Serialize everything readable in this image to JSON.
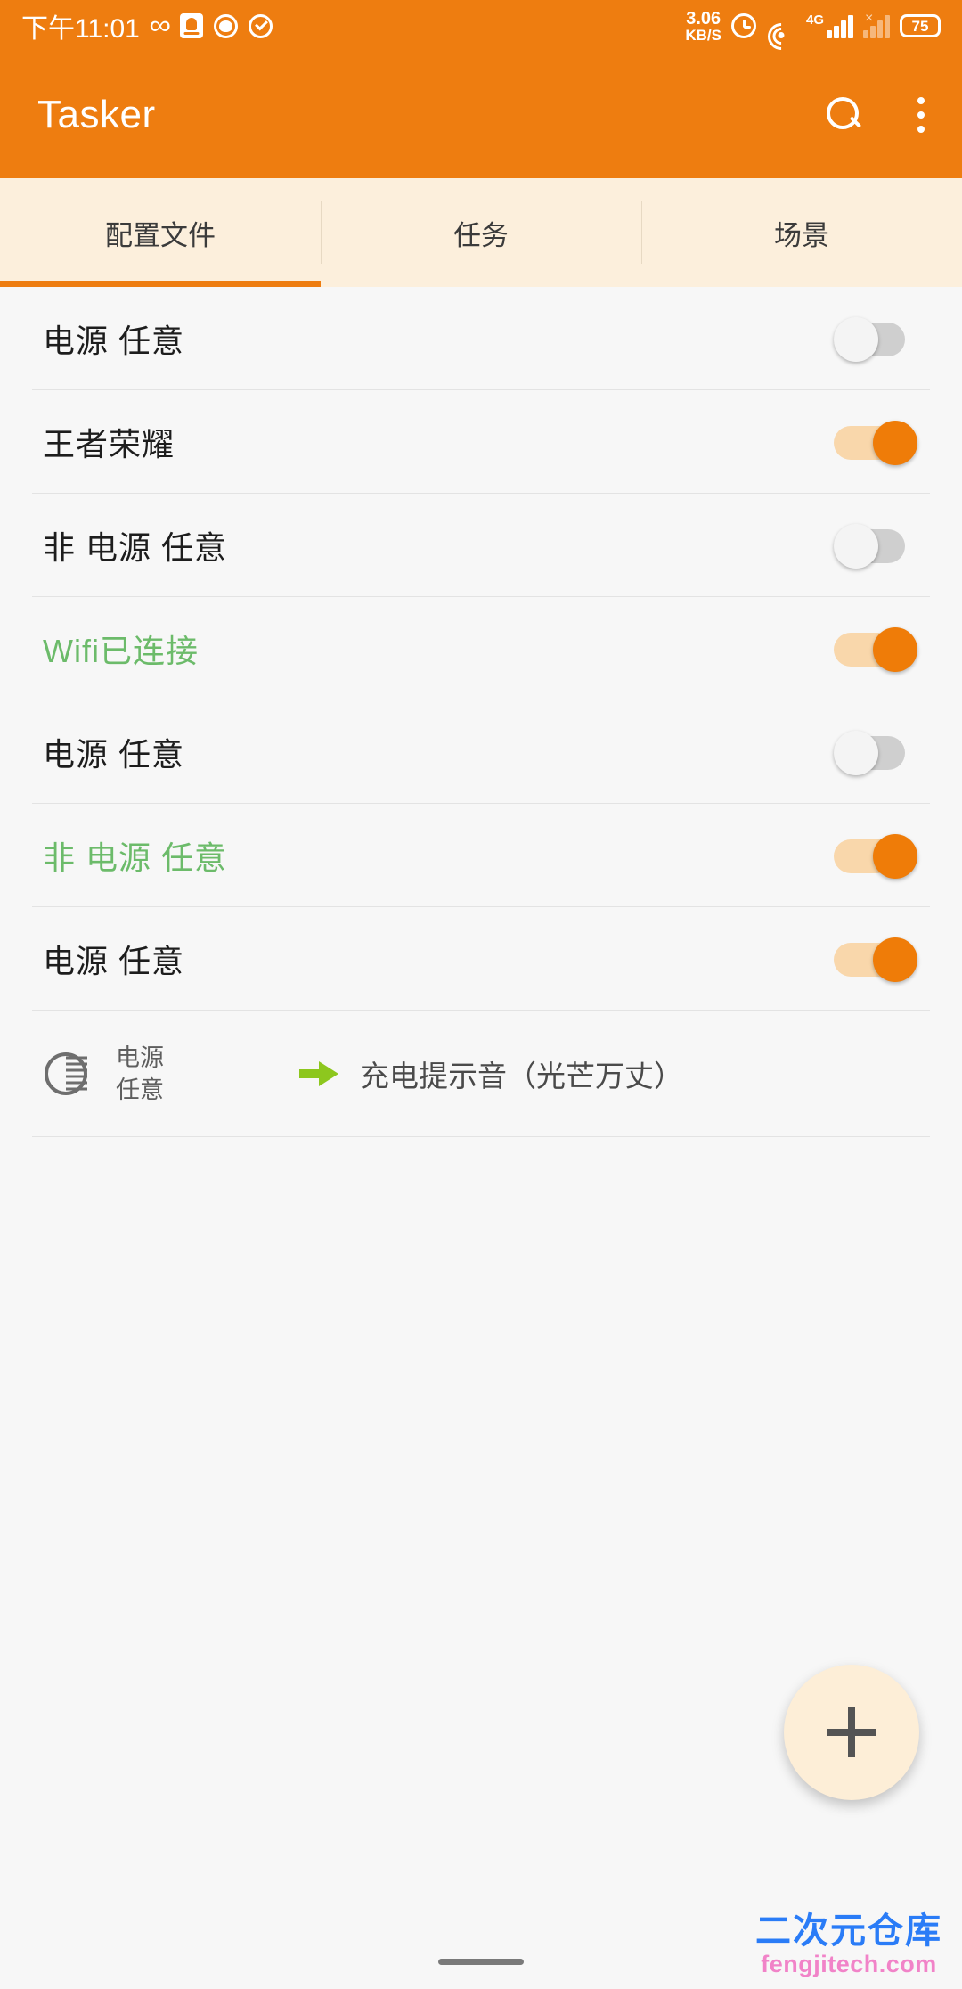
{
  "status_bar": {
    "clock": "下午11:01",
    "left_icons": [
      "infinity-icon",
      "notification-box-icon",
      "circle-dot-icon",
      "check-circle-icon"
    ],
    "network_speed_value": "3.06",
    "network_speed_unit": "KB/S",
    "alarm_icon": "alarm-icon",
    "wifi_icon": "wifi-icon",
    "sim1_label": "4G",
    "sim2_state": "×",
    "battery_level": "75",
    "background_color": "#ee7d10"
  },
  "app_bar": {
    "title": "Tasker",
    "search_icon": "search-icon",
    "overflow_icon": "overflow-menu-icon",
    "background_color": "#ee7d10"
  },
  "tabs": {
    "items": [
      {
        "label": "配置文件",
        "active": true
      },
      {
        "label": "任务",
        "active": false
      },
      {
        "label": "场景",
        "active": false
      }
    ],
    "background_color": "#fcefdc",
    "indicator_color": "#ee7d10"
  },
  "profiles": [
    {
      "name": "电源 任意",
      "enabled": false,
      "active_color": false
    },
    {
      "name": "王者荣耀",
      "enabled": true,
      "active_color": false
    },
    {
      "name": "非 电源 任意",
      "enabled": false,
      "active_color": false
    },
    {
      "name": "Wifi已连接",
      "enabled": true,
      "active_color": true
    },
    {
      "name": "电源 任意",
      "enabled": false,
      "active_color": false
    },
    {
      "name": "非 电源 任意",
      "enabled": true,
      "active_color": true
    },
    {
      "name": "电源 任意",
      "enabled": true,
      "active_color": false
    }
  ],
  "expanded_detail": {
    "context_icon": "power-state-icon",
    "context_line1": "电源",
    "context_line2": "任意",
    "arrow_icon": "green-arrow-icon",
    "task_name": "充电提示音（光芒万丈）"
  },
  "fab": {
    "icon": "plus-icon",
    "background_color": "#fdeed7"
  },
  "watermark": {
    "title": "二次元仓库",
    "url": "fengjitech.com",
    "title_color": "#2a7cf7",
    "url_color": "#f183c8"
  },
  "nav_bar": {
    "pill": "gesture-pill"
  },
  "colors": {
    "accent": "#ee7d10",
    "toggle_on_thumb": "#ef7c08",
    "toggle_on_track": "#f9d7ab",
    "active_profile_text": "#6cbb6a",
    "arrow_green": "#8dc71e"
  }
}
